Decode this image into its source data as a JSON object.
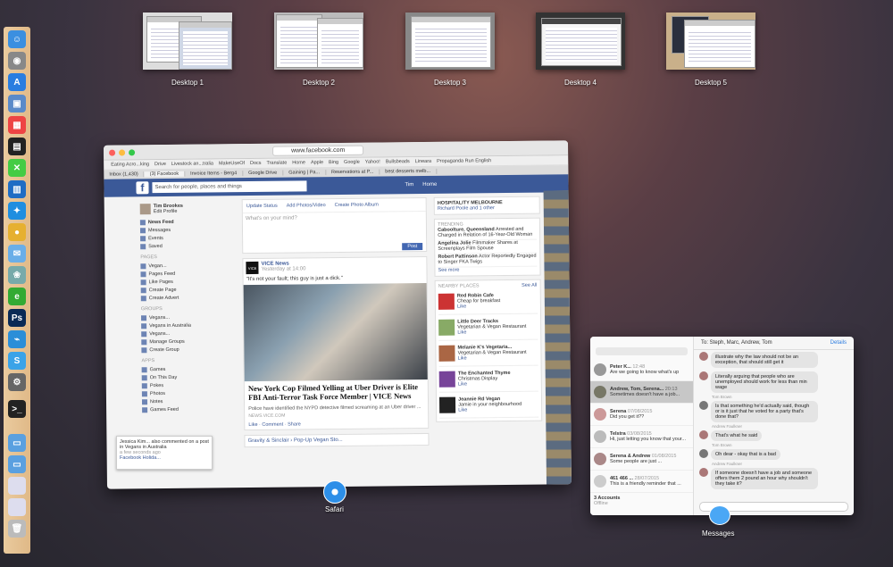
{
  "spaces": [
    {
      "label": "Desktop 1"
    },
    {
      "label": "Desktop 2"
    },
    {
      "label": "Desktop 3"
    },
    {
      "label": "Desktop 4"
    },
    {
      "label": "Desktop 5"
    }
  ],
  "safari": {
    "app_label": "Safari",
    "url": "www.facebook.com",
    "bookmarks": [
      "Eating Acro...king",
      "Drive",
      "Livestock an...tralia",
      "MakeUseOf",
      "Docs",
      "Translate",
      "Home",
      "Apple",
      "Bing",
      "Google",
      "Yahoo!",
      "Bullsbeads",
      "Lineara",
      "Propaganda Run English"
    ],
    "tabs": [
      "Inbox (1,430)",
      "(3) Facebook",
      "Invoice Items - Berg4",
      "Google Drive",
      "Gaining | Pa...",
      "Reservations at P...",
      "best desserts melb..."
    ],
    "facebook": {
      "search_placeholder": "Search for people, places and things",
      "user_name": "Tim",
      "home_label": "Home",
      "profile_name": "Tim Brookes",
      "edit_profile": "Edit Profile",
      "left_nav": [
        {
          "label": "News Feed"
        },
        {
          "label": "Messages"
        },
        {
          "label": "Events"
        },
        {
          "label": "Saved"
        }
      ],
      "pages_header": "PAGES",
      "pages": [
        {
          "label": "Vegan..."
        },
        {
          "label": "Pages Feed"
        },
        {
          "label": "Like Pages"
        },
        {
          "label": "Create Page"
        },
        {
          "label": "Create Advert"
        }
      ],
      "groups_header": "GROUPS",
      "groups": [
        {
          "label": "Vegans..."
        },
        {
          "label": "Vegans in Australia"
        },
        {
          "label": "Vegans..."
        },
        {
          "label": "Manage Groups"
        },
        {
          "label": "Create Group"
        }
      ],
      "apps_header": "APPS",
      "apps": [
        {
          "label": "Games"
        },
        {
          "label": "On This Day"
        },
        {
          "label": "Pokes"
        },
        {
          "label": "Photos"
        },
        {
          "label": "Notes"
        },
        {
          "label": "Games Feed"
        }
      ],
      "composer": {
        "tab_status": "Update Status",
        "tab_photo": "Add Photos/Video",
        "tab_album": "Create Photo Album",
        "placeholder": "What's on your mind?",
        "post_button": "Post"
      },
      "post": {
        "source": "VICE News",
        "time": "Yesterday at 14:00",
        "caption": "\"It's not your fault; this guy is just a dick.\"",
        "headline": "New York Cop Filmed Yelling at Uber Driver is Elite FBI Anti-Terror Task Force Member | VICE News",
        "snippet": "Police have identified the NYPD detective filmed screaming at an Uber driver ...",
        "domain": "NEWS.VICE.COM",
        "actions": "Like · Comment · Share"
      },
      "next_post": "Gravity & Sinclair › Pop-Up Vegan Sto...",
      "right": {
        "event": "HOSPITALITY MELBOURNE",
        "event_sub": "Richard Poole and 1 other",
        "trending_header": "TRENDING",
        "trends": [
          {
            "title": "Caboolture, Queensland",
            "desc": "Arrested and Charged in Relation of 16-Year-Old Woman"
          },
          {
            "title": "Angelina Jolie",
            "desc": "Filmmaker Shares at Screenplays Film Spouse"
          },
          {
            "title": "Robert Pattinson",
            "desc": "Actor Reportedly Engaged to Singer FKA Twigs"
          }
        ],
        "see_more": "See more",
        "nearby_header": "NEARBY PLACES",
        "see_all": "See All",
        "places": [
          {
            "name": "Red Robin Cafe",
            "desc": "Cheap for breakfast",
            "like": "Like"
          },
          {
            "name": "Little Deer Tracks",
            "desc": "Vegetarian & Vegan Restaurant",
            "like": "Like"
          },
          {
            "name": "Melanie K's Vegetaria...",
            "desc": "Vegetarian & Vegan Restaurant",
            "like": "Like"
          },
          {
            "name": "The Enchanted Thyme",
            "desc": "Christmas Display",
            "like": "Like"
          },
          {
            "name": "Jeannie Rd Vegan",
            "desc": "Jamie in your neighbourhood",
            "like": "Like"
          }
        ]
      },
      "notification": {
        "text": "Jessica Kim... also commented on a post in Vegans in Australia",
        "time": "a few seconds ago",
        "footer": "Facebook Holida..."
      }
    }
  },
  "messages": {
    "app_label": "Messages",
    "to": "To: Steph, Marc, Andrew, Tom",
    "details": "Details",
    "conversations": [
      {
        "name": "Peter K...",
        "preview": "Are we going to know what's up",
        "time": "12:48",
        "selected": false
      },
      {
        "name": "Andrew, Tom, Serena...",
        "preview": "Sometimes doesn't have a job...",
        "time": "20:13",
        "selected": true
      },
      {
        "name": "Serena",
        "preview": "Did you get it??",
        "time": "07/08/2015",
        "selected": false
      },
      {
        "name": "Telstra",
        "preview": "Hi, just letting you know that your...",
        "time": "03/08/2015",
        "selected": false
      },
      {
        "name": "Serena & Andrew",
        "preview": "Some people are just ...",
        "time": "01/08/2015",
        "selected": false
      },
      {
        "name": "461 466 ...",
        "preview": "This is a friendly reminder that ...",
        "time": "28/07/2015",
        "selected": false
      }
    ],
    "accounts_label": "3 Accounts",
    "offline_label": "Offline",
    "bubbles": [
      {
        "sender": "",
        "text": "illustrate why the law should not be an exception, that should still get it"
      },
      {
        "sender": "",
        "text": "Literally arguing that people who are unemployed should work for less than min wage"
      },
      {
        "sender": "Tom Brown",
        "text": "Is that something he'd actually said, though or is it just that he voted for a party that's done that?"
      },
      {
        "sender": "Andrew Faulkner",
        "text": "That's what he said"
      },
      {
        "sender": "Tom Brown",
        "text": "Oh dear - okay that is a bad"
      },
      {
        "sender": "Andrew Faulkner",
        "text": "If someone doesn't have a job and someone offers them 2 pound an hour why shouldn't they take it?"
      }
    ]
  }
}
